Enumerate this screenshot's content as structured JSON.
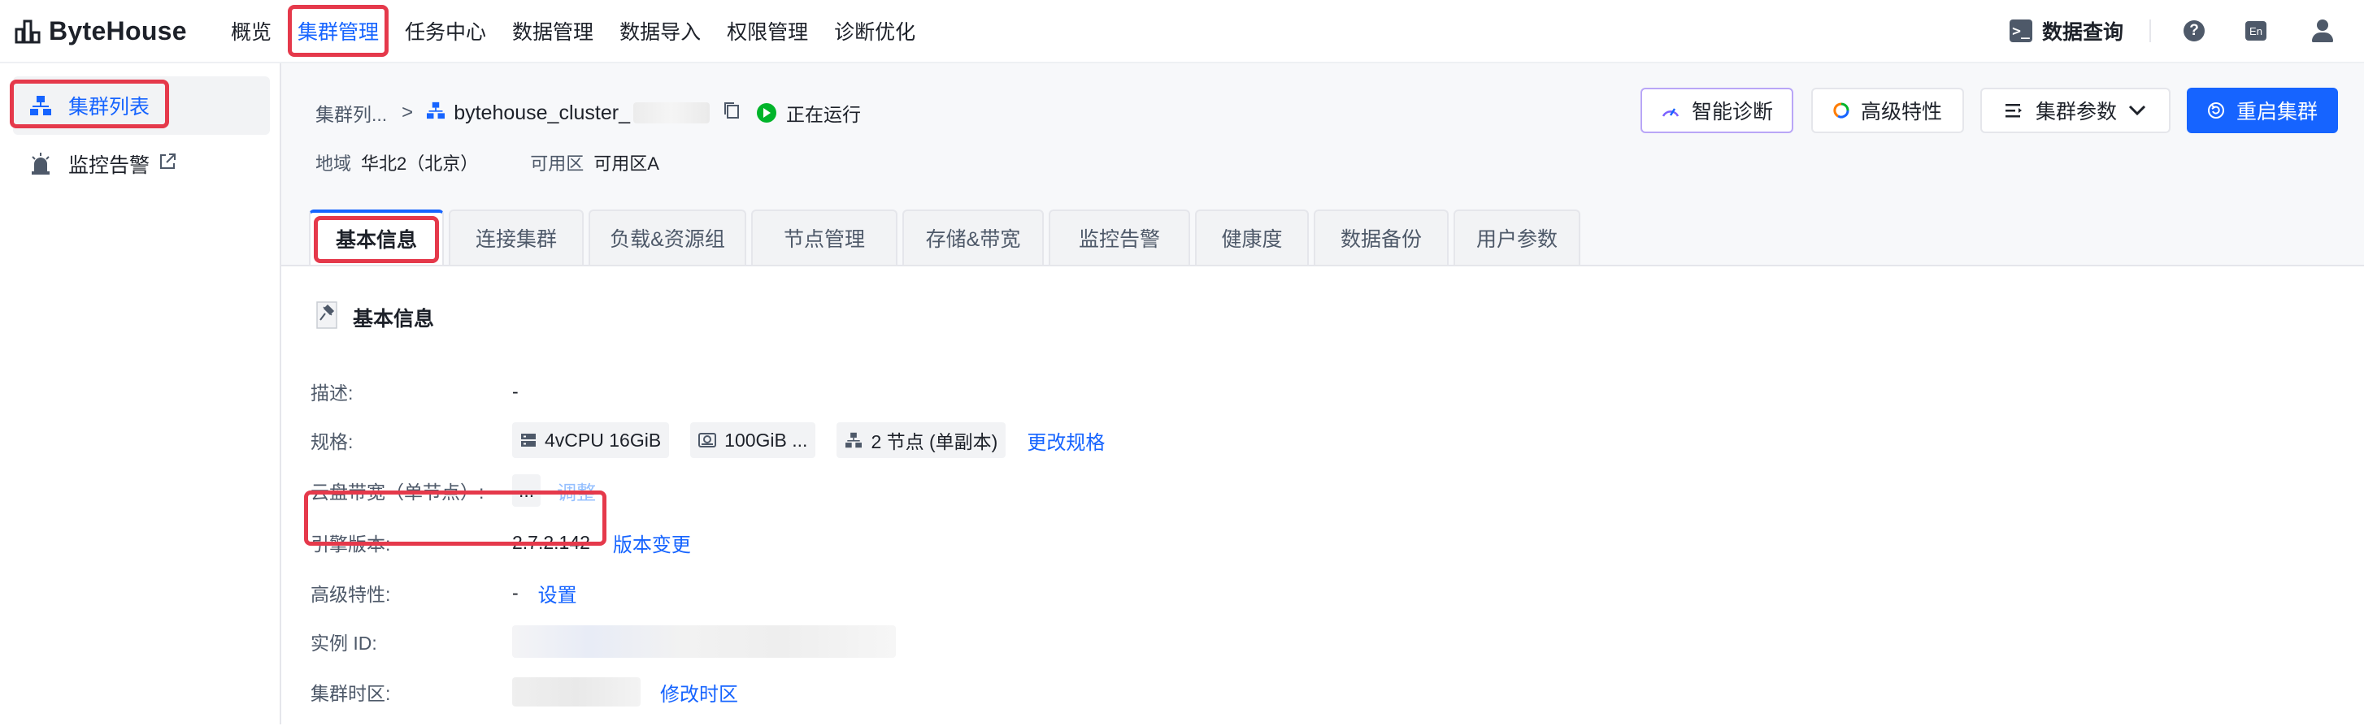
{
  "app": {
    "logo_text": "ByteHouse"
  },
  "nav": {
    "items": [
      {
        "label": "概览",
        "active": false
      },
      {
        "label": "集群管理",
        "active": true
      },
      {
        "label": "任务中心",
        "active": false
      },
      {
        "label": "数据管理",
        "active": false
      },
      {
        "label": "数据导入",
        "active": false
      },
      {
        "label": "权限管理",
        "active": false
      },
      {
        "label": "诊断优化",
        "active": false
      }
    ],
    "data_query_label": "数据查询",
    "help_icon_text": "?",
    "lang_icon_text": "En"
  },
  "sidebar": {
    "items": [
      {
        "label": "集群列表",
        "active": true,
        "icon": "cluster-list-icon"
      },
      {
        "label": "监控告警",
        "active": false,
        "icon": "alarm-icon"
      }
    ]
  },
  "header": {
    "breadcrumb_parent": "集群列...",
    "breadcrumb_sep": ">",
    "cluster_name": "bytehouse_cluster_",
    "status": "正在运行",
    "region_label": "地域",
    "region_value": "华北2（北京）",
    "zone_label": "可用区",
    "zone_value": "可用区A",
    "buttons": {
      "diagnose": "智能诊断",
      "advanced": "高级特性",
      "params": "集群参数",
      "restart": "重启集群"
    }
  },
  "tabs": [
    {
      "label": "基本信息",
      "active": true
    },
    {
      "label": "连接集群",
      "active": false
    },
    {
      "label": "负载&资源组",
      "active": false
    },
    {
      "label": "节点管理",
      "active": false
    },
    {
      "label": "存储&带宽",
      "active": false
    },
    {
      "label": "监控告警",
      "active": false
    },
    {
      "label": "健康度",
      "active": false
    },
    {
      "label": "数据备份",
      "active": false
    },
    {
      "label": "用户参数",
      "active": false
    }
  ],
  "basic_info": {
    "section_title": "基本信息",
    "description_label": "描述:",
    "description_value": "-",
    "spec_label": "规格:",
    "spec_cpu": "4vCPU 16GiB",
    "spec_disk": "100GiB ...",
    "spec_nodes": "2 节点 (单副本)",
    "spec_change_link": "更改规格",
    "bandwidth_label": "云盘带宽（单节点）:",
    "bandwidth_value": "...",
    "bandwidth_adjust_link": "调整",
    "engine_label": "引擎版本:",
    "engine_value": "2.7.2.142",
    "engine_change_link": "版本变更",
    "advanced_label": "高级特性:",
    "advanced_value": "-",
    "advanced_link": "设置",
    "instance_label": "实例 ID:",
    "timezone_label": "集群时区:",
    "timezone_link": "修改时区"
  },
  "colors": {
    "accent": "#1664ff",
    "highlight": "#e5394b",
    "running": "#00b42a"
  }
}
